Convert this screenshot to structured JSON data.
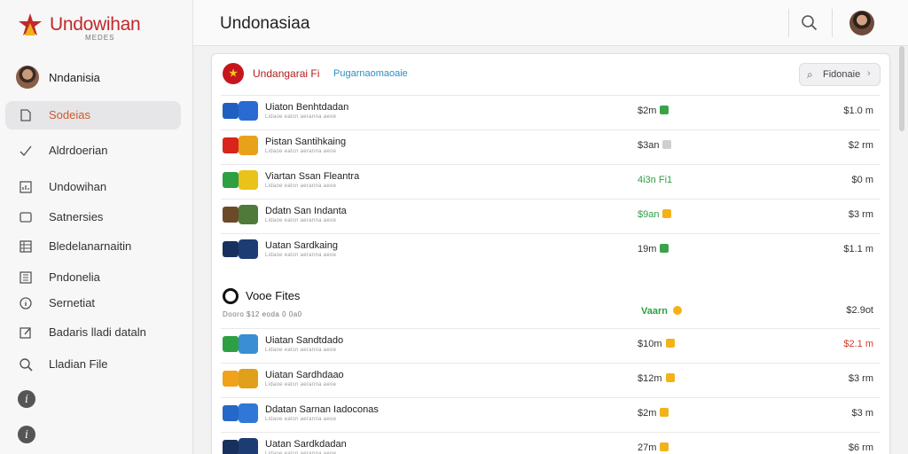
{
  "app": {
    "logo_text": "Undowihan",
    "logo_sub": "MEDES"
  },
  "sidebar": {
    "profile_name": "Nndanisia",
    "items": [
      {
        "label": "Sodeias",
        "icon": "document-icon",
        "active": true
      },
      {
        "label": "Aldrdoerian",
        "icon": "check-icon",
        "active": false
      },
      {
        "label": "Undowihan",
        "icon": "chart-icon",
        "active": false
      },
      {
        "label": "Satnersies",
        "icon": "square-icon",
        "active": false
      },
      {
        "label": "Bledelanarnaitin",
        "icon": "grid-icon",
        "active": false
      },
      {
        "label": "Pndonelia",
        "icon": "list-icon",
        "active": false
      },
      {
        "label": "Sernetiat",
        "icon": "info-icon",
        "active": false
      },
      {
        "label": "Badaris lladi dataln",
        "icon": "edit-icon",
        "active": false
      },
      {
        "label": "Lladian File",
        "icon": "search-icon",
        "active": false
      }
    ]
  },
  "topbar": {
    "title": "Undonasiaa"
  },
  "card": {
    "title": "Undangarai Fi",
    "subtitle": "Pugarnaomaoaie",
    "filter_label": "Fidonaie",
    "rows": [
      {
        "title": "Uiaton Benhtdadan",
        "sub": "Lidaoe ealcn aeranna aeoe",
        "mid": "$2m",
        "mid_color": "#333333",
        "badge_color": "#3aa34a",
        "right": "$1.0 m",
        "right_color": "#333333",
        "icon1": "#1f5fbf",
        "icon2": "#2a6bd3"
      },
      {
        "title": "Pistan Santihkaing",
        "sub": "Lidaoe ealcn aeranna aeoe",
        "mid": "$3an",
        "mid_color": "#333333",
        "badge_color": "#cfcfcf",
        "right": "$2 rm",
        "right_color": "#333333",
        "icon1": "#d8241c",
        "icon2": "#e8a21a"
      },
      {
        "title": "Viartan Ssan Fleantra",
        "sub": "Lidaoe ealcn aeranna aeoe",
        "mid": "4i3n Fi1",
        "mid_color": "#2ea043",
        "badge_color": "",
        "right": "$0 m",
        "right_color": "#333333",
        "icon1": "#2ea043",
        "icon2": "#e9c21a"
      },
      {
        "title": "Ddatn San Indanta",
        "sub": "Lidaoe ealcn aeranna aeoe",
        "mid": "$9an",
        "mid_color": "#2ea043",
        "badge_color": "#f2b21a",
        "right": "$3 rm",
        "right_color": "#333333",
        "icon1": "#6b4a2a",
        "icon2": "#4f7a3a"
      },
      {
        "title": "Uatan Sardkaing",
        "sub": "Lidaoe ealcn aeranna aeoe",
        "mid": "19m",
        "mid_color": "#333333",
        "badge_color": "#3aa34a",
        "right": "$1.1 m",
        "right_color": "#333333",
        "icon1": "#17305e",
        "icon2": "#1e3c74"
      }
    ],
    "section2": {
      "title": "Vooe Fites",
      "sub": "Dooro $12 eoda 0 0a0",
      "mid": "Vaarn",
      "right": "$2.9ot"
    },
    "rows2": [
      {
        "title": "Uiatan Sandtdado",
        "sub": "Lidaoe ealcn aeranna aeoe",
        "mid": "$10m",
        "mid_color": "#333333",
        "badge_color": "#f2b21a",
        "right": "$2.1 m",
        "right_color": "#d13a2a",
        "icon1": "#2ea043",
        "icon2": "#3a8ed3"
      },
      {
        "title": "Uiatan Sardhdaao",
        "sub": "Lidaoe ealcn aeranna aeoe",
        "mid": "$12m",
        "mid_color": "#333333",
        "badge_color": "#f2b21a",
        "right": "$3 rm",
        "right_color": "#333333",
        "icon1": "#f0a21a",
        "icon2": "#e0a01a"
      },
      {
        "title": "Ddatan Sarnan Iadoconas",
        "sub": "Lidaoe ealcn aeranna aeoe",
        "mid": "$2m",
        "mid_color": "#333333",
        "badge_color": "#f2b21a",
        "right": "$3 m",
        "right_color": "#333333",
        "icon1": "#2468c8",
        "icon2": "#2f78d6"
      },
      {
        "title": "Uatan Sardkdadan",
        "sub": "Lidaoe ealcn aeranna aeoe",
        "mid": "27m",
        "mid_color": "#333333",
        "badge_color": "#f2b21a",
        "right": "$6 rm",
        "right_color": "#333333",
        "icon1": "#17305e",
        "icon2": "#1e3c74"
      }
    ]
  }
}
